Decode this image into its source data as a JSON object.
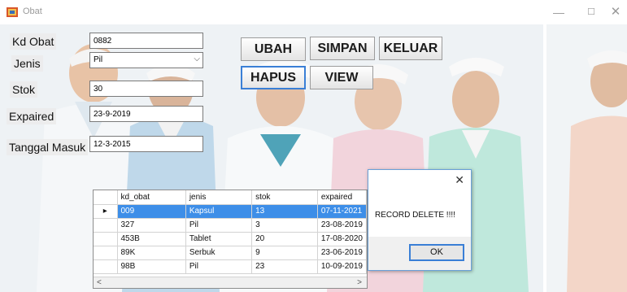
{
  "window": {
    "title": "Obat",
    "min_glyph": "—",
    "max_glyph": "☐",
    "close_glyph": "✕"
  },
  "form": {
    "kd_obat": {
      "label": "Kd Obat",
      "value": "0882"
    },
    "jenis": {
      "label": "Jenis",
      "value": "Pil"
    },
    "stok": {
      "label": "Stok",
      "value": "30"
    },
    "expaired": {
      "label": "Expaired",
      "value": "23-9-2019"
    },
    "tanggal_masuk": {
      "label": "Tanggal Masuk",
      "value": "12-3-2015"
    }
  },
  "buttons": {
    "ubah": "UBAH",
    "simpan": "SIMPAN",
    "keluar": "KELUAR",
    "hapus": "HAPUS",
    "view": "VIEW"
  },
  "grid": {
    "columns": [
      "kd_obat",
      "jenis",
      "stok",
      "expaired"
    ],
    "rows": [
      [
        "009",
        "Kapsul",
        "13",
        "07-11-2021"
      ],
      [
        "327",
        "Pil",
        "3",
        "23-08-2019"
      ],
      [
        "453B",
        "Tablet",
        "20",
        "17-08-2020"
      ],
      [
        "89K",
        "Serbuk",
        "9",
        "23-06-2019"
      ],
      [
        "98B",
        "Pil",
        "23",
        "10-09-2019"
      ]
    ],
    "selected_row_marker": "▸",
    "scroll_left": "<",
    "scroll_right": ">"
  },
  "message_box": {
    "close_glyph": "✕",
    "text": "RECORD DELETE !!!!",
    "ok_label": "OK"
  },
  "colors": {
    "selection": "#3d8ee8",
    "focus_border": "#3a7fd6"
  }
}
